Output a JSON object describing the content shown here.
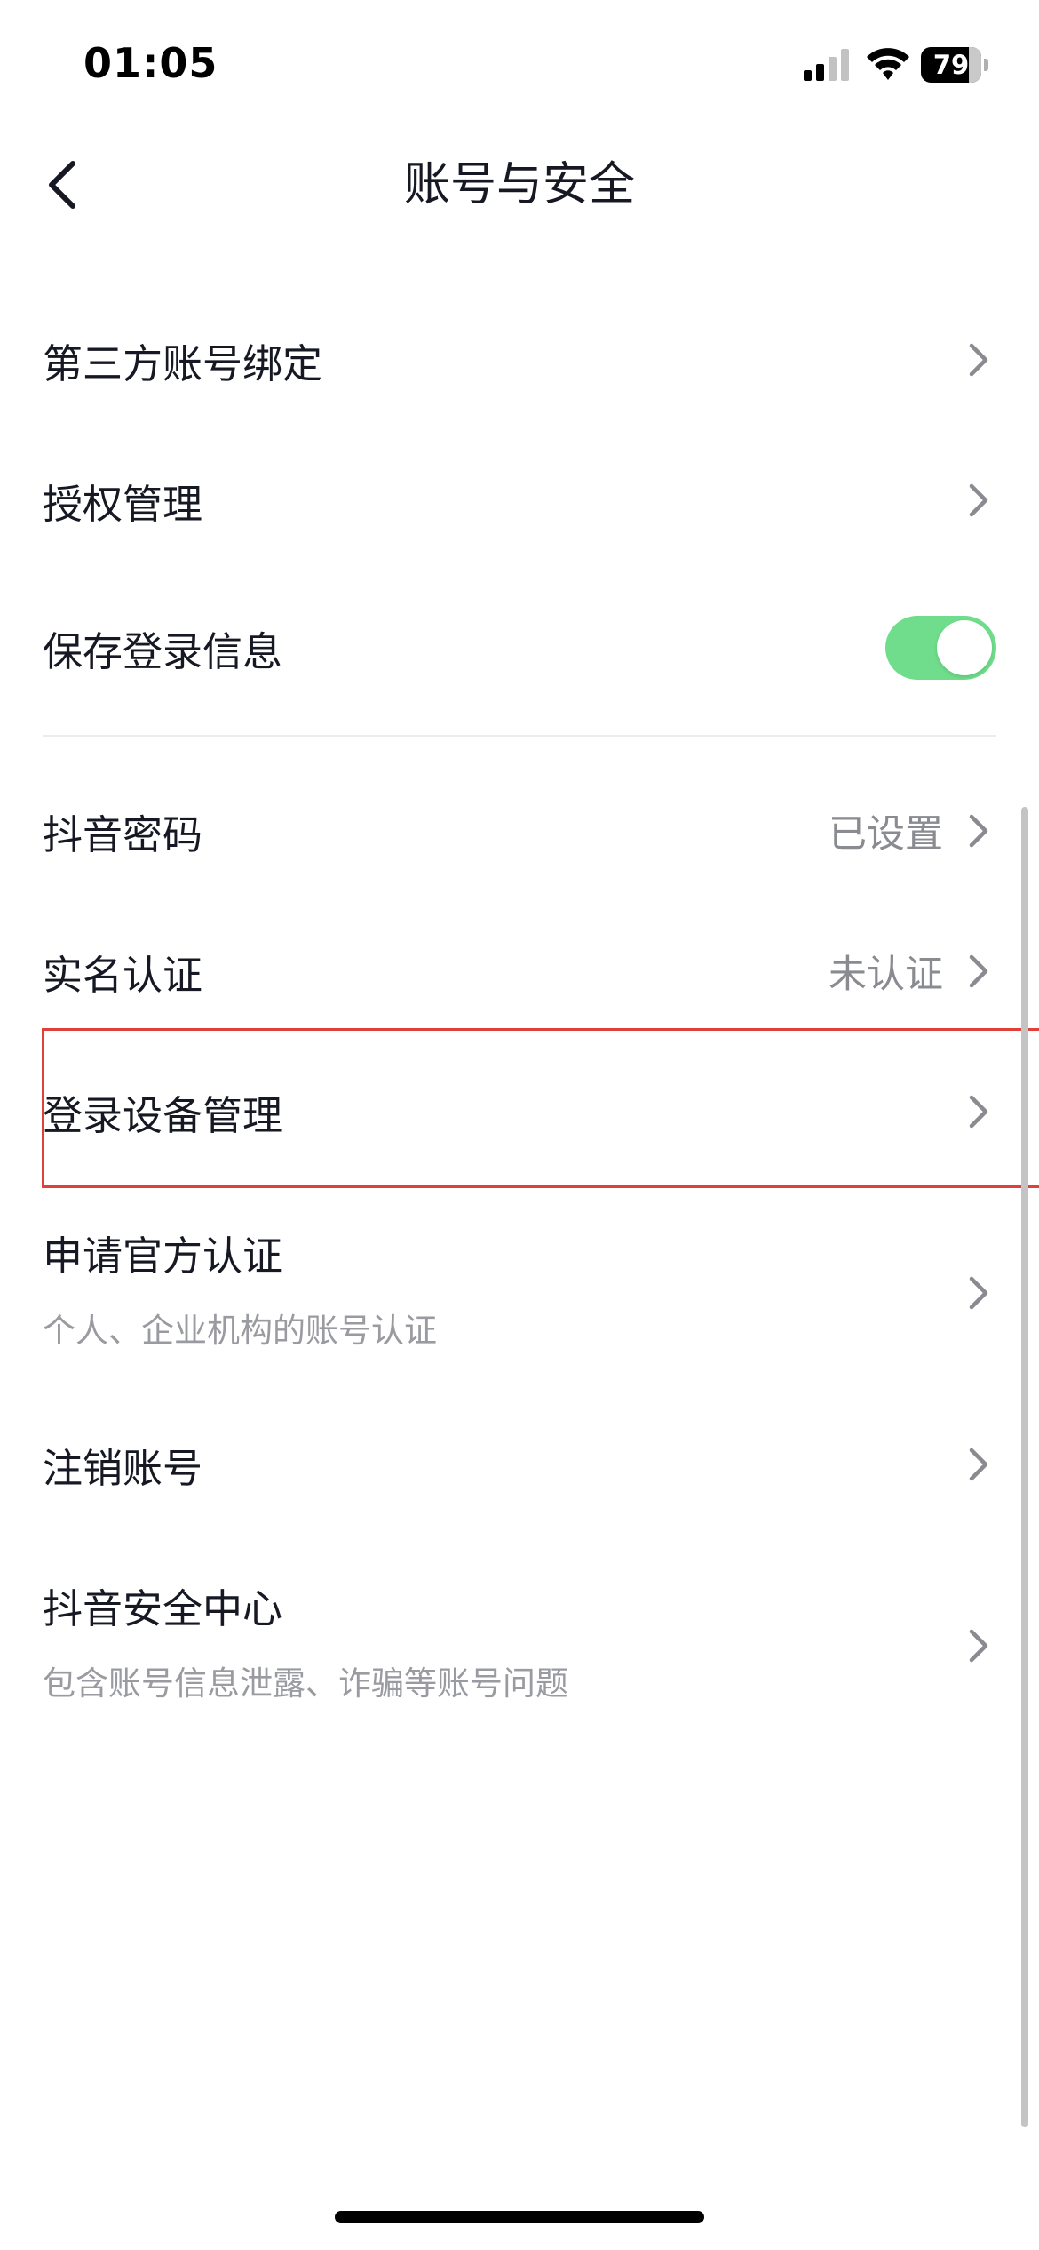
{
  "status_bar": {
    "time": "01:05",
    "battery": "79",
    "icons": [
      "signal-icon",
      "wifi-icon",
      "battery-icon"
    ]
  },
  "nav": {
    "title": "账号与安全",
    "back_icon": "chevron-left-icon"
  },
  "settings": {
    "items": [
      {
        "label": "第三方账号绑定"
      },
      {
        "label": "授权管理"
      },
      {
        "label": "保存登录信息",
        "toggle_on": true
      },
      {
        "label": "抖音密码",
        "value": "已设置"
      },
      {
        "label": "实名认证",
        "value": "未认证"
      },
      {
        "label": "登录设备管理",
        "highlighted": true
      },
      {
        "label": "申请官方认证",
        "subtitle": "个人、企业机构的账号认证"
      },
      {
        "label": "注销账号"
      },
      {
        "label": "抖音安全中心",
        "subtitle": "包含账号信息泄露、诈骗等账号问题"
      }
    ]
  },
  "colors": {
    "toggle_on": "#6fdd8b",
    "highlight_border": "#e0403a",
    "primary_text": "#161823",
    "secondary_text": "#9a9ba0"
  }
}
